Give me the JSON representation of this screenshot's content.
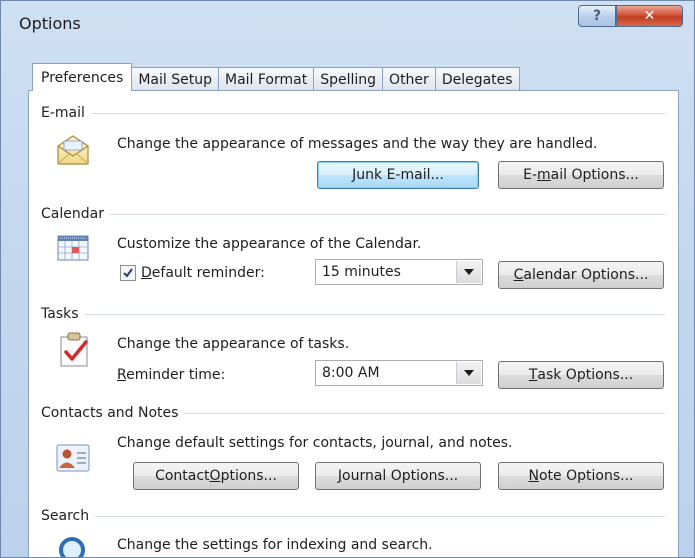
{
  "window": {
    "title": "Options",
    "help_label": "?",
    "close_label": "✕"
  },
  "tabs": [
    {
      "label": "Preferences",
      "active": true
    },
    {
      "label": "Mail Setup",
      "active": false
    },
    {
      "label": "Mail Format",
      "active": false
    },
    {
      "label": "Spelling",
      "active": false
    },
    {
      "label": "Other",
      "active": false
    },
    {
      "label": "Delegates",
      "active": false
    }
  ],
  "email": {
    "heading": "E-mail",
    "icon": "envelope-icon",
    "description": "Change the appearance of messages and the way they are handled.",
    "junk_label": "Junk E-mail...",
    "options_pre": "E-",
    "options_u": "m",
    "options_post": "ail Options..."
  },
  "calendar": {
    "heading": "Calendar",
    "icon": "calendar-icon",
    "description": "Customize the appearance of the Calendar.",
    "reminder_checked": true,
    "reminder_u": "D",
    "reminder_post": "efault reminder:",
    "reminder_value": "15 minutes",
    "options_u": "C",
    "options_post": "alendar Options..."
  },
  "tasks": {
    "heading": "Tasks",
    "icon": "task-check-icon",
    "description": "Change the appearance of tasks.",
    "reminder_u": "R",
    "reminder_post": "eminder time:",
    "reminder_value": "8:00 AM",
    "options_u": "T",
    "options_post": "ask Options..."
  },
  "contacts": {
    "heading": "Contacts and Notes",
    "icon": "contact-card-icon",
    "description": "Change default settings for contacts, journal, and notes.",
    "contact_pre": "Contact ",
    "contact_u": "O",
    "contact_post": "ptions...",
    "journal_u": "J",
    "journal_post": "ournal Options...",
    "note_pre": "",
    "note_u": "N",
    "note_post": "ote Options..."
  },
  "search": {
    "heading": "Search",
    "icon": "search-icon",
    "description": "Change the settings for indexing and search."
  },
  "colors": {
    "title_bg": "#c4d8ef",
    "close": "#c13b22",
    "focus_border": "#3c7fb1"
  }
}
